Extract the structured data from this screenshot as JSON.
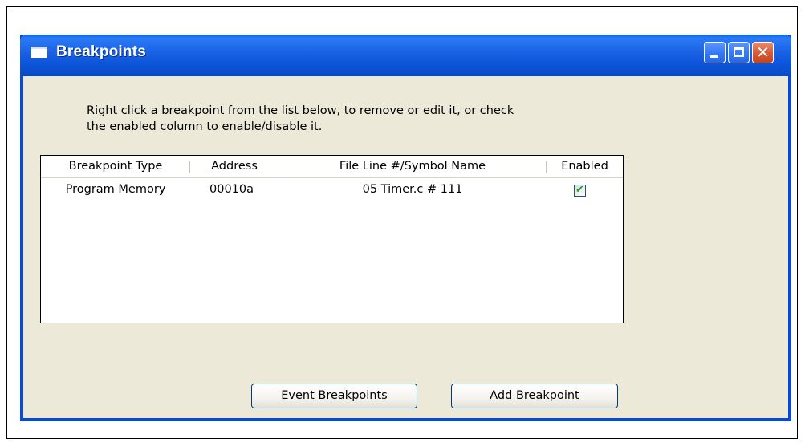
{
  "window": {
    "title": "Breakpoints",
    "icon": "window-icon",
    "controls": {
      "minimize": "minimize-icon",
      "maximize": "maximize-icon",
      "close": "close-icon"
    }
  },
  "instructions": {
    "line1": "Right click a breakpoint from the list below, to remove or edit it, or check",
    "line2": "the enabled column to enable/disable it."
  },
  "table": {
    "columns": [
      "Breakpoint Type",
      "Address",
      "File Line #/Symbol Name",
      "Enabled"
    ],
    "rows": [
      {
        "type": "Program Memory",
        "address": "00010a",
        "location": "05 Timer.c # 111",
        "enabled": true
      }
    ]
  },
  "buttons": {
    "event_breakpoints": "Event Breakpoints",
    "add_breakpoint": "Add Breakpoint"
  },
  "colors": {
    "titlebar": "#0c55d8",
    "window_bg": "#ece9d8",
    "check": "#21a121"
  }
}
